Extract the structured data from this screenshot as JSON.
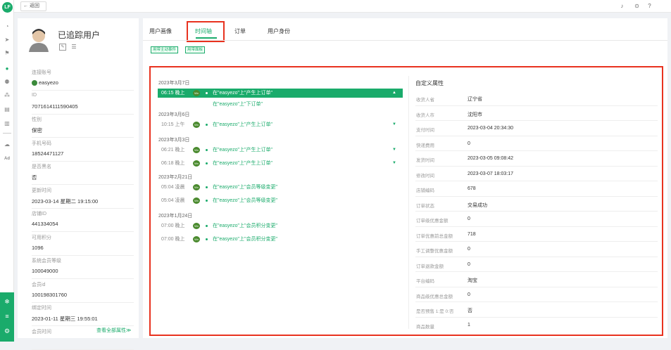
{
  "app": {
    "logo_text": "LF"
  },
  "topbar": {
    "back_label": "← 返回"
  },
  "profile": {
    "name": "已追踪用户"
  },
  "fields": [
    {
      "label": "连接账号",
      "value": "easyezo",
      "wx": true
    },
    {
      "label": "ID",
      "value": "7071614111590405"
    },
    {
      "label": "性别",
      "value": "保密"
    },
    {
      "label": "手机号码",
      "value": "18524471127"
    },
    {
      "label": "是否黑名",
      "value": "否"
    },
    {
      "label": "更新时间",
      "value": "2023-03-14 星期二 19:15:00"
    },
    {
      "label": "店铺ID",
      "value": "441334054"
    },
    {
      "label": "可用积分",
      "value": "1096"
    },
    {
      "label": "系统会员等级",
      "value": "100049000"
    },
    {
      "label": "会员id",
      "value": "100198301760"
    },
    {
      "label": "绑定时间",
      "value": "2023-01-11 星期三 19:55:01"
    },
    {
      "label": "会员时间",
      "value": ""
    }
  ],
  "see_all": "查看全部属性≫",
  "tabs": [
    "用户画像",
    "时间轴",
    "订单",
    "用户身份"
  ],
  "filters": [
    "用带主动事件",
    "用带面板"
  ],
  "timeline": {
    "dates": [
      "2023年3月7日",
      "2023年3月6日",
      "2023年3月3日",
      "2023年2月21日",
      "2023年1月24日"
    ],
    "events": [
      {
        "time": "06:15 晚上",
        "text": "在\"easyezo\"上\"产生上订单\"",
        "arrow": "▲"
      },
      {
        "time": "10:15 上午",
        "text": "在\"easyezo\"上\"产生上订单\"",
        "arrow": "▼"
      },
      {
        "time": "06:21 晚上",
        "text": "在\"easyezo\"上\"产生上订单\"",
        "arrow": "▼"
      },
      {
        "time": "06:18 晚上",
        "text": "在\"easyezo\"上\"产生上订单\"",
        "arrow": "▼"
      },
      {
        "time": "05:04 凌晨",
        "text": "在\"easyezo\"上\"会员等级变更\"",
        "arrow": ""
      },
      {
        "time": "05:04 凌晨",
        "text": "在\"easyezo\"上\"会员等级变更\"",
        "arrow": ""
      },
      {
        "time": "07:00 晚上",
        "text": "在\"easyezo\"上\"会员积分变更\"",
        "arrow": ""
      },
      {
        "time": "07:00 晚上",
        "text": "在\"easyezo\"上\"会员积分变更\"",
        "arrow": ""
      }
    ],
    "sub_event": "在\"easyezo\"上\"下订单\"",
    "wx_label": "Wx"
  },
  "attributes": {
    "title": "自定义属性",
    "rows": [
      {
        "key": "收货人省",
        "value": "辽宁省"
      },
      {
        "key": "收货人市",
        "value": "沈阳市"
      },
      {
        "key": "支付时间",
        "value": "2023-03-04 20:34:30"
      },
      {
        "key": "快递费用",
        "value": "0"
      },
      {
        "key": "发货时间",
        "value": "2023-03-05 09:08:42"
      },
      {
        "key": "修改时间",
        "value": "2023-03-07 18:03:17"
      },
      {
        "key": "店铺编码",
        "value": "678"
      },
      {
        "key": "订单状态",
        "value": "交易成功"
      },
      {
        "key": "订单级优惠金额",
        "value": "0"
      },
      {
        "key": "订单优惠前总金额",
        "value": "718"
      },
      {
        "key": "手工调整优惠金额",
        "value": "0"
      },
      {
        "key": "订单退款金额",
        "value": "0"
      },
      {
        "key": "平台编码",
        "value": "淘宝"
      },
      {
        "key": "商品级优惠总金额",
        "value": "0"
      },
      {
        "key": "是否预售 1:是 0:否",
        "value": "否"
      },
      {
        "key": "商品数量",
        "value": "1"
      }
    ]
  }
}
